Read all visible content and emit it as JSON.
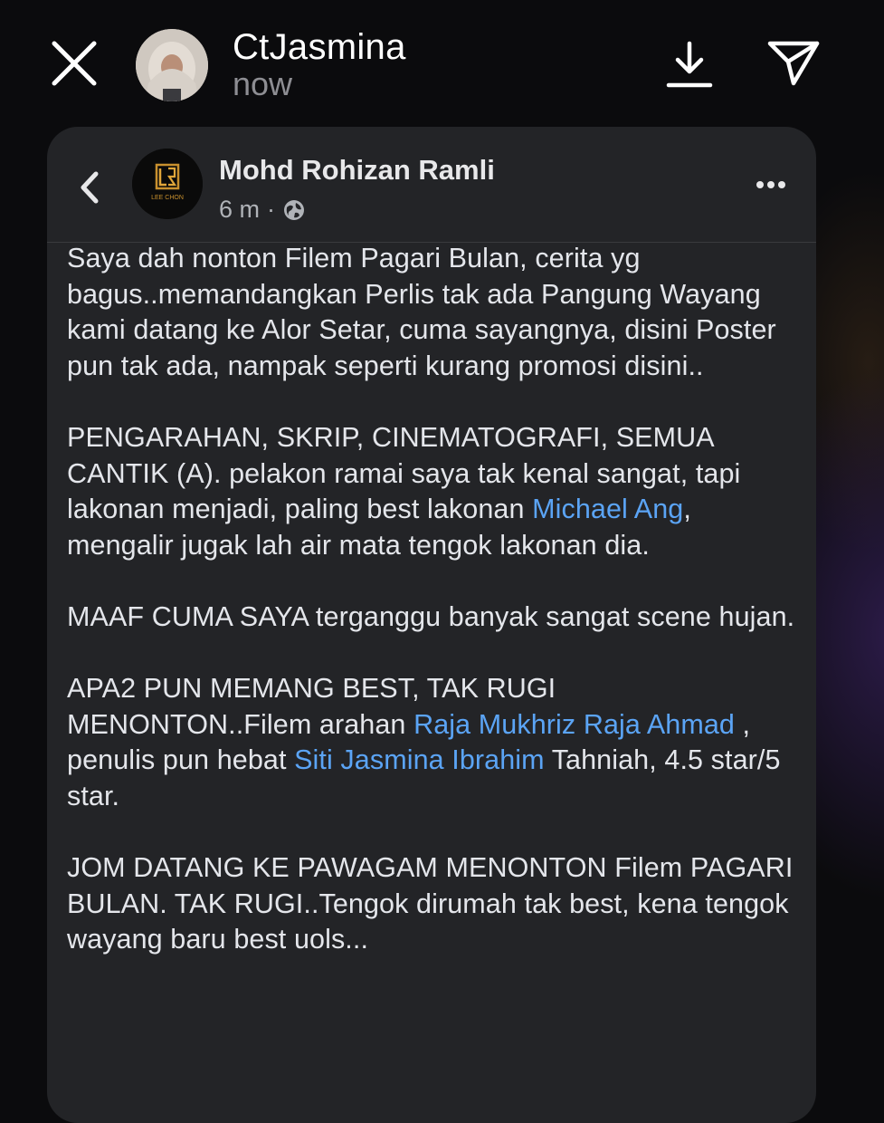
{
  "story": {
    "username": "CtJasmina",
    "time": "now",
    "icons": [
      "close-icon",
      "download-icon",
      "send-icon"
    ]
  },
  "post": {
    "author": "Mohd Rohizan Ramli",
    "time": "6 m",
    "separator": "·",
    "logo_text": "LEE CHON",
    "paragraphs": [
      [
        {
          "text": "Saya dah nonton Filem Pagari Bulan, cerita yg bagus..memandangkan Perlis tak ada Pangung Wayang kami datang ke Alor Setar, cuma sayangnya, disini Poster pun tak ada, nampak seperti kurang promosi disini.."
        }
      ],
      [
        {
          "text": "PENGARAHAN, SKRIP, CINEMATOGRAFI, SEMUA CANTIK (A). pelakon ramai saya tak kenal sangat, tapi lakonan menjadi, paling best lakonan "
        },
        {
          "text": "Michael Ang",
          "link": true
        },
        {
          "text": ", mengalir jugak lah air mata tengok lakonan dia."
        }
      ],
      [
        {
          "text": "MAAF CUMA SAYA terganggu banyak sangat scene hujan."
        }
      ],
      [
        {
          "text": "APA2 PUN MEMANG BEST, TAK RUGI MENONTON..Filem arahan "
        },
        {
          "text": "Raja Mukhriz Raja Ahmad",
          "link": true
        },
        {
          "text": " , penulis pun hebat "
        },
        {
          "text": "Siti Jasmina Ibrahim",
          "link": true
        },
        {
          "text": " Tahniah, 4.5 star/5 star."
        }
      ],
      [
        {
          "text": "JOM DATANG KE PAWAGAM MENONTON Filem PAGARI BULAN. TAK RUGI..Tengok dirumah tak best, kena tengok wayang baru best uols..."
        }
      ]
    ]
  },
  "colors": {
    "background": "#0b0b0d",
    "card": "#232427",
    "link": "#5ba4f5",
    "muted": "#8e8e93",
    "body_text": "#e4e6eb"
  }
}
